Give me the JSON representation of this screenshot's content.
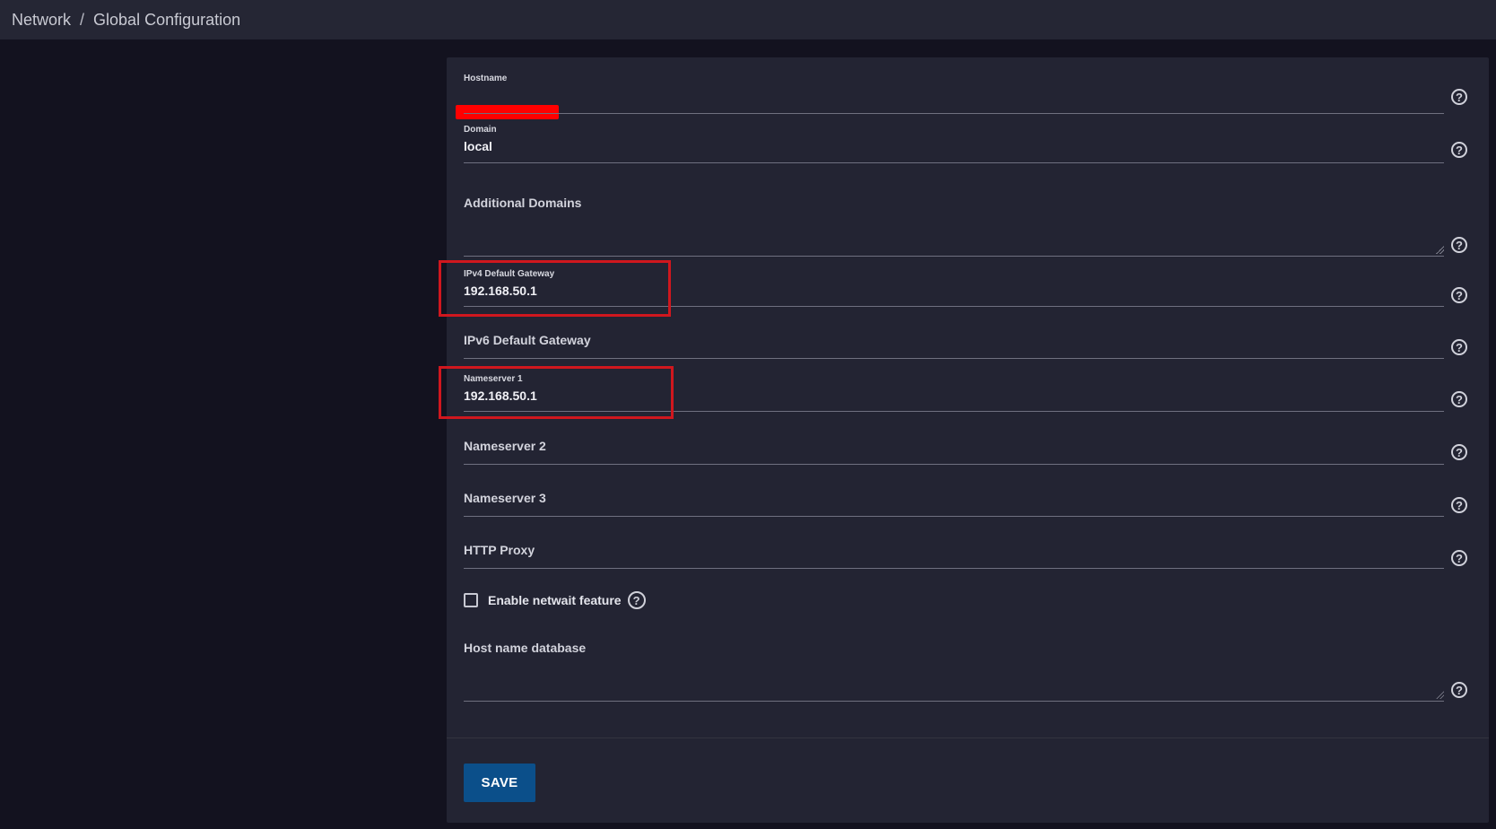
{
  "breadcrumb": {
    "parent": "Network",
    "separator": "/",
    "current": "Global Configuration"
  },
  "form": {
    "hostname": {
      "label": "Hostname",
      "value": ""
    },
    "domain": {
      "label": "Domain",
      "value": "local"
    },
    "additional_domains": {
      "label": "Additional Domains"
    },
    "ipv4_gateway": {
      "label": "IPv4 Default Gateway",
      "value": "192.168.50.1"
    },
    "ipv6_gateway": {
      "label": "IPv6 Default Gateway"
    },
    "nameserver1": {
      "label": "Nameserver 1",
      "value": "192.168.50.1"
    },
    "nameserver2": {
      "label": "Nameserver 2"
    },
    "nameserver3": {
      "label": "Nameserver 3"
    },
    "http_proxy": {
      "label": "HTTP Proxy"
    },
    "netwait": {
      "label": "Enable netwait feature",
      "checked": false
    },
    "host_db": {
      "label": "Host name database"
    },
    "help_glyph": "?",
    "save_label": "SAVE"
  },
  "colors": {
    "background": "#13121f",
    "panel": "#232433",
    "topbar": "#252634",
    "save_button": "#0b4f8a",
    "highlight": "#d0171e",
    "redaction": "#ff0000"
  },
  "icons": {
    "help": "question-circle-icon",
    "resize": "resize-handle-icon"
  }
}
